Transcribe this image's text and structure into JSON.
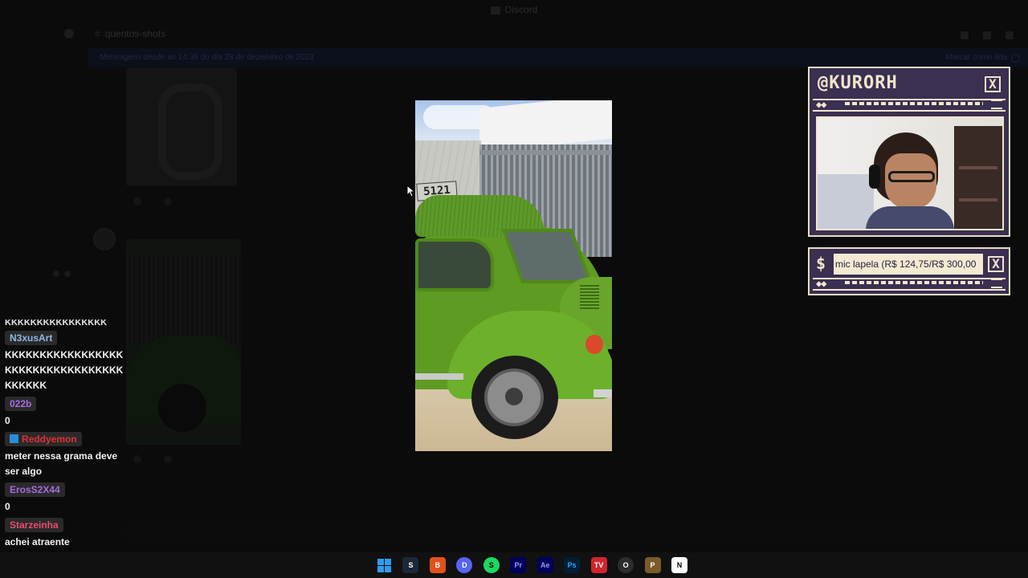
{
  "discord": {
    "title": "Discord",
    "channel": "quentos-shots",
    "banner_text": "Mensagens desde as 14:36 do dia 28 de dezembro de 2023",
    "banner_action": "Marcar como lida"
  },
  "video": {
    "plate_number": "5121"
  },
  "webcam": {
    "handle": "@KURORH",
    "close": "X"
  },
  "donation": {
    "symbol": "$",
    "ticker_text": "mic lapela (R$ 124,75/R$ 300,00",
    "close": "X"
  },
  "chat": {
    "cutoff_line": "KKKKKKKKKKKKKKKK",
    "messages": [
      {
        "user": "N3xusArt",
        "color": "#8fb6e8",
        "badge": false,
        "text": "KKKKKKKKKKKKKKKKKKKKKKKKKKKKKKKKKKKKKKKK"
      },
      {
        "user": "022b",
        "color": "#a66ce6",
        "badge": false,
        "text": "0"
      },
      {
        "user": "Reddyemon",
        "color": "#e0303a",
        "badge": true,
        "text": "meter nessa grama deve ser algo"
      },
      {
        "user": "ErosS2X44",
        "color": "#a56ce0",
        "badge": false,
        "text": "0"
      },
      {
        "user": "Starzeinha",
        "color": "#e94c6c",
        "badge": false,
        "text": "achei atraente"
      }
    ]
  },
  "taskbar": {
    "apps": [
      {
        "name": "windows-start",
        "label": ""
      },
      {
        "name": "steam",
        "label": "S",
        "color": "#1b2838"
      },
      {
        "name": "brave",
        "label": "B",
        "color": "#e0521c"
      },
      {
        "name": "discord",
        "label": "D",
        "color": "#5865f2"
      },
      {
        "name": "spotify",
        "label": "S",
        "color": "#1ed760"
      },
      {
        "name": "premiere",
        "label": "Pr",
        "color": "#00005b"
      },
      {
        "name": "after-effects",
        "label": "Ae",
        "color": "#00005b"
      },
      {
        "name": "photoshop",
        "label": "Ps",
        "color": "#001e36"
      },
      {
        "name": "video-app",
        "label": "TV",
        "color": "#d1252c"
      },
      {
        "name": "obs",
        "label": "O",
        "color": "#2d2d2d"
      },
      {
        "name": "pen-tool",
        "label": "P",
        "color": "#7a5b2a"
      },
      {
        "name": "notion",
        "label": "N",
        "color": "#ffffff"
      }
    ]
  }
}
